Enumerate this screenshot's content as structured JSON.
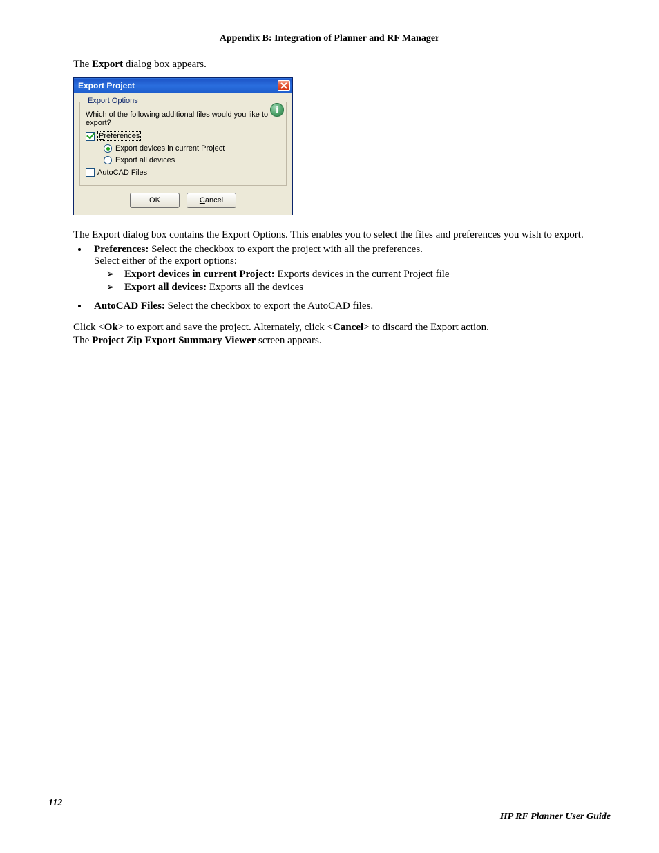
{
  "header": {
    "title": "Appendix B: Integration of Planner and RF Manager"
  },
  "intro": {
    "prefix": "The ",
    "bold": "Export",
    "suffix": " dialog box appears."
  },
  "dialog": {
    "title": "Export Project",
    "group_legend": "Export Options",
    "question": "Which of the following additional files would you like to export?",
    "preferences_label_first": "P",
    "preferences_label_rest": "references",
    "radio1": "Export devices in current Project",
    "radio2": "Export all devices",
    "autocad_label": "AutoCAD Files",
    "ok": "OK",
    "cancel_first": "C",
    "cancel_rest": "ancel"
  },
  "desc": {
    "text": "The Export dialog box contains the Export Options. This enables you to select the files and preferences you wish to export."
  },
  "bullets": {
    "pref_label": "Preferences:",
    "pref_text": " Select the checkbox to export the project with all the preferences.",
    "pref_sub": "Select either of the export options:",
    "tri1_b": "Export devices in current Project:",
    "tri1_t": " Exports devices in the current Project file",
    "tri2_b": "Export all devices:",
    "tri2_t": " Exports all the devices",
    "auto_label": "AutoCAD Files:",
    "auto_text": " Select the checkbox to export the AutoCAD files."
  },
  "click": {
    "p1a": "Click <",
    "p1b": "Ok",
    "p1c": "> to export and save the project. Alternately, click <",
    "p1d": "Cancel",
    "p1e": "> to discard the Export action.",
    "p2a": "The ",
    "p2b": "Project Zip Export Summary Viewer",
    "p2c": " screen appears."
  },
  "footer": {
    "page": "112",
    "guide": "HP RF Planner User Guide"
  }
}
